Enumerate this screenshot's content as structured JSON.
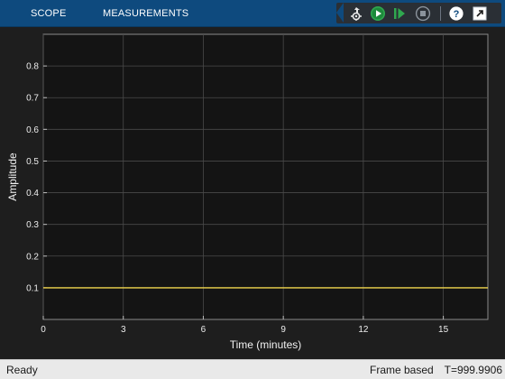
{
  "toolstrip": {
    "tabs": [
      {
        "label": "SCOPE"
      },
      {
        "label": "MEASUREMENTS"
      }
    ],
    "quick_access": [
      {
        "icon": "step-back-icon"
      },
      {
        "icon": "run-icon"
      },
      {
        "icon": "step-forward-icon"
      },
      {
        "icon": "stop-icon"
      },
      {
        "icon": "help-icon"
      },
      {
        "icon": "undock-icon"
      }
    ]
  },
  "colors": {
    "toolstrip_bg": "#0e4a7e",
    "plot_bg": "#141414",
    "grid": "#4a4a4a",
    "signal": "#f2d64e",
    "run_green": "#2fa84f"
  },
  "chart_data": {
    "type": "line",
    "title": "",
    "xlabel": "Time (minutes)",
    "ylabel": "Amplitude",
    "xlim": [
      0,
      16.67
    ],
    "ylim": [
      0,
      0.9
    ],
    "xticks": [
      0,
      3,
      6,
      9,
      12,
      15
    ],
    "yticks": [
      0.1,
      0.2,
      0.3,
      0.4,
      0.5,
      0.6,
      0.7,
      0.8
    ],
    "ytick_labels": [
      "0.1",
      "0.2",
      "0.3",
      "0.4",
      "0.5",
      "0.6",
      "0.7",
      "0.8"
    ],
    "grid": true,
    "series": [
      {
        "x": [
          0,
          16.67
        ],
        "y": [
          0.1,
          0.1
        ],
        "color": "#f2d64e"
      }
    ]
  },
  "status": {
    "state": "Ready",
    "mode": "Frame based",
    "time": "T=999.9906"
  }
}
